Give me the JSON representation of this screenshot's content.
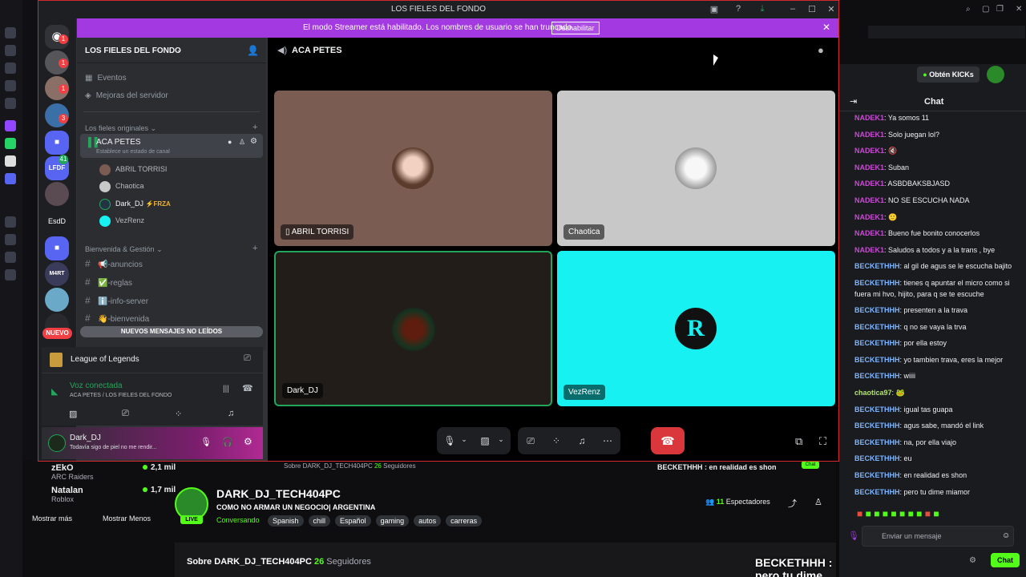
{
  "window": {
    "title": "LOS FIELES DEL FONDO",
    "title_icon": "discord-logo"
  },
  "streamer_banner": {
    "text": "El modo Streamer está habilitado. Los nombres de usuario se han truncado.",
    "button": "Deshabilitar"
  },
  "server": {
    "name": "LOS FIELES DEL FONDO",
    "menu_items": [
      "Eventos",
      "Mejoras del servidor"
    ]
  },
  "rail": {
    "badges": [
      "1",
      "1",
      "1",
      "3",
      "41"
    ],
    "labels": [
      "LFDF",
      "EsdD",
      "M4RT"
    ],
    "nuevo": "NUEVO"
  },
  "categories": [
    {
      "label": "Los fieles originales"
    },
    {
      "label": "Bienvenida & Gestión"
    }
  ],
  "voice_channel": {
    "name": "ACA PETES",
    "status": "Establece un estado de canal",
    "users": [
      {
        "name": "ABRIL TORRISI"
      },
      {
        "name": "Chaotica"
      },
      {
        "name": "Dark_DJ",
        "tag": "FRZA"
      },
      {
        "name": "VezRenz"
      }
    ]
  },
  "text_channels": [
    {
      "name": "-anuncios",
      "emoji": "📢"
    },
    {
      "name": "-reglas",
      "emoji": "✅"
    },
    {
      "name": "-info-server",
      "emoji": "ℹ️"
    },
    {
      "name": "-bienvenida",
      "emoji": "👋"
    }
  ],
  "new_messages": "NUEVOS MENSAJES NO LEÍDOS",
  "game": {
    "name": "League of Legends"
  },
  "voice_status": {
    "title": "Voz conectada",
    "subtitle": "ACA PETES / LOS FIELES DEL FONDO"
  },
  "current_user": {
    "name": "Dark_DJ",
    "status": "Todavía sigo de piel no me rendir..."
  },
  "stage": {
    "title": "ACA PETES",
    "tiles": [
      {
        "name": "ABRIL TORRISI",
        "bg": "#7a5c52"
      },
      {
        "name": "Chaotica",
        "bg": "#c8c8c8"
      },
      {
        "name": "Dark_DJ",
        "bg": "#231d1a"
      },
      {
        "name": "VezRenz",
        "bg": "#18f1f1"
      }
    ]
  },
  "kick": {
    "streamers": [
      {
        "name": "zEkO",
        "game": "ARC Raiders",
        "viewers": "2,1 mil"
      },
      {
        "name": "Natalan",
        "game": "Roblox",
        "viewers": "1,7 mil"
      }
    ],
    "show_more": "Mostrar más",
    "show_less": "Mostrar Menos",
    "channel": "DARK_DJ_TECH404PC",
    "stream_title": "COMO NO ARMAR UN NEGOCIO| ARGENTINA",
    "category": "Conversando",
    "tags": [
      "Spanish",
      "chill",
      "Español",
      "gaming",
      "autos",
      "carreras"
    ],
    "viewers_num": "11",
    "viewers_label": "Espectadores",
    "live": "LIVE",
    "about_prefix": "Sobre",
    "followers_num": "26",
    "followers_label": "Seguidores",
    "overlay_small": "BECKETHHH : en realidad es shon",
    "overlay_big": "BECKETHHH : pero tu dime miamor"
  },
  "chat": {
    "header": "Chat",
    "kicks_button": "Obtén KICKs",
    "messages": [
      {
        "user": "NADEK1",
        "text": "Ya somos 11"
      },
      {
        "user": "NADEK1",
        "text": "Solo juegan lol?"
      },
      {
        "user": "NADEK1",
        "text": "🔇"
      },
      {
        "user": "NADEK1",
        "text": "Suban"
      },
      {
        "user": "NADEK1",
        "text": "ASBDBAKSBJASD"
      },
      {
        "user": "NADEK1",
        "text": "NO SE ESCUCHA NADA"
      },
      {
        "user": "NADEK1",
        "text": "🙂"
      },
      {
        "user": "NADEK1",
        "text": "Bueno fue bonito conocerlos"
      },
      {
        "user": "NADEK1",
        "text": "Saludos a todos y a la trans , bye"
      },
      {
        "user": "BECKETHHH",
        "text": "al gil de agus se le escucha bajito"
      },
      {
        "user": "BECKETHHH",
        "text": "tienes q apuntar el micro como si fuera mi hvo, hijito, para q se te escuche"
      },
      {
        "user": "BECKETHHH",
        "text": "presenten a la trava"
      },
      {
        "user": "BECKETHHH",
        "text": "q no se vaya la trva"
      },
      {
        "user": "BECKETHHH",
        "text": "por ella estoy"
      },
      {
        "user": "BECKETHHH",
        "text": "yo tambien trava, eres la mejor"
      },
      {
        "user": "BECKETHHH",
        "text": "wiiii"
      },
      {
        "user": "chaotica97",
        "text": "🐸"
      },
      {
        "user": "BECKETHHH",
        "text": "igual tas guapa"
      },
      {
        "user": "BECKETHHH",
        "text": "agus sabe, mandó el link"
      },
      {
        "user": "BECKETHHH",
        "text": "na, por ella viajo"
      },
      {
        "user": "BECKETHHH",
        "text": "eu"
      },
      {
        "user": "BECKETHHH",
        "text": "en realidad es shon"
      },
      {
        "user": "BECKETHHH",
        "text": "pero tu dime miamor"
      }
    ],
    "input_placeholder": "Enviar un mensaje",
    "send_label": "Chat",
    "mini_chat_label": "Chat"
  }
}
